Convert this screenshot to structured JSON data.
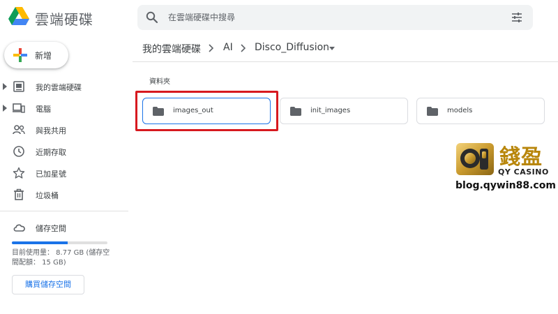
{
  "header": {
    "app_title": "雲端硬碟",
    "search_placeholder": "在雲端硬碟中搜尋",
    "logo_icon": "google-drive-logo",
    "search_icon": "search-icon",
    "filter_icon": "tune-icon"
  },
  "sidebar": {
    "new_button_label": "新增",
    "items": [
      {
        "label": "我的雲端硬碟",
        "icon": "my-drive-icon",
        "expandable": true
      },
      {
        "label": "電腦",
        "icon": "computer-icon",
        "expandable": true
      },
      {
        "label": "與我共用",
        "icon": "shared-icon",
        "expandable": false
      },
      {
        "label": "近期存取",
        "icon": "recent-icon",
        "expandable": false
      },
      {
        "label": "已加星號",
        "icon": "star-icon",
        "expandable": false
      },
      {
        "label": "垃圾桶",
        "icon": "trash-icon",
        "expandable": false
      }
    ],
    "storage": {
      "label": "儲存空間",
      "usage_text": "目前使用量： 8.77 GB (儲存空間配額： 15 GB)",
      "used_gb": 8.77,
      "quota_gb": 15,
      "buy_button_label": "購買儲存空間"
    }
  },
  "breadcrumb": {
    "items": [
      "我的雲端硬碟",
      "AI",
      "Disco_Diffusion"
    ]
  },
  "main": {
    "section_label": "資料夾",
    "folders": [
      {
        "name": "images_out",
        "selected": true
      },
      {
        "name": "init_images",
        "selected": false
      },
      {
        "name": "models",
        "selected": false
      }
    ]
  },
  "watermark": {
    "brand_cn": "錢盈",
    "brand_en": "QY CASINO",
    "url": "blog.qywin88.com"
  },
  "colors": {
    "accent": "#1a73e8",
    "highlight": "#d7191f",
    "search_bg": "#f1f3f4"
  }
}
